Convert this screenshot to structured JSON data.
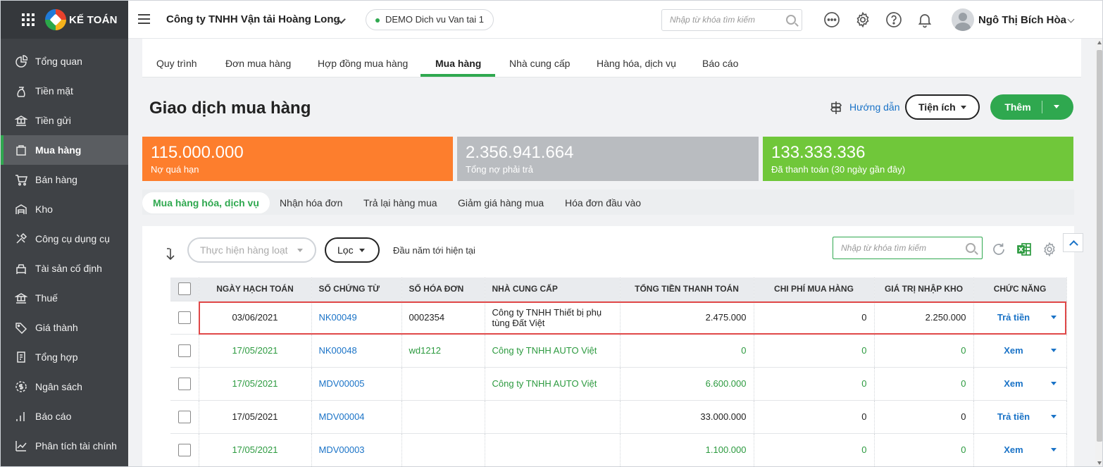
{
  "app": {
    "logo_text": "KẾ TOÁN"
  },
  "sidebar": {
    "items": [
      {
        "label": "Tổng quan",
        "icon": "dashboard-icon"
      },
      {
        "label": "Tiền mặt",
        "icon": "money-bag-icon"
      },
      {
        "label": "Tiền gửi",
        "icon": "bank-deposit-icon"
      },
      {
        "label": "Mua hàng",
        "icon": "purchase-icon"
      },
      {
        "label": "Bán hàng",
        "icon": "cart-icon"
      },
      {
        "label": "Kho",
        "icon": "warehouse-icon"
      },
      {
        "label": "Công cụ dụng cụ",
        "icon": "tools-icon"
      },
      {
        "label": "Tài sản cố định",
        "icon": "fixed-asset-icon"
      },
      {
        "label": "Thuế",
        "icon": "tax-icon"
      },
      {
        "label": "Giá thành",
        "icon": "price-tag-icon"
      },
      {
        "label": "Tổng hợp",
        "icon": "summary-icon"
      },
      {
        "label": "Ngân sách",
        "icon": "budget-icon"
      },
      {
        "label": "Báo cáo",
        "icon": "report-icon"
      },
      {
        "label": "Phân tích tài chính",
        "icon": "analysis-icon"
      }
    ],
    "active_index": 3
  },
  "header": {
    "company": "Công ty TNHH Vận tải Hoàng Long",
    "database": "DEMO Dich vu Van tai 1",
    "search_placeholder": "Nhập từ khóa tìm kiếm",
    "user_name": "Ngô Thị Bích Hòa"
  },
  "tabs": [
    "Quy trình",
    "Đơn mua hàng",
    "Hợp đồng mua hàng",
    "Mua hàng",
    "Nhà cung cấp",
    "Hàng hóa, dịch vụ",
    "Báo cáo"
  ],
  "active_tab": "Mua hàng",
  "page": {
    "title": "Giao dịch mua hàng",
    "guide_label": "Hướng dẫn",
    "utility_label": "Tiện ích",
    "add_label": "Thêm"
  },
  "summary_cards": [
    {
      "value": "115.000.000",
      "label": "Nợ quá hạn",
      "color": "#fd7e2d"
    },
    {
      "value": "2.356.941.664",
      "label": "Tổng nợ phải trả",
      "color": "#b9bcc0"
    },
    {
      "value": "133.333.336",
      "label": "Đã thanh toán (30 ngày gần đây)",
      "color": "#70c73a"
    }
  ],
  "subtabs": [
    "Mua hàng hóa, dịch vụ",
    "Nhận hóa đơn",
    "Trả lại hàng mua",
    "Giảm giá hàng mua",
    "Hóa đơn đầu vào"
  ],
  "toolbar": {
    "bulk_label": "Thực hiện hàng loạt",
    "filter_label": "Lọc",
    "period": "Đầu năm tới hiện tại",
    "search_placeholder": "Nhập từ khóa tìm kiếm"
  },
  "table": {
    "columns": [
      "NGÀY HẠCH TOÁN",
      "SỐ CHỨNG TỪ",
      "SỐ HÓA ĐƠN",
      "NHÀ CUNG CẤP",
      "TỔNG TIỀN THANH TOÁN",
      "CHI PHÍ MUA HÀNG",
      "GIÁ TRỊ NHẬP KHO",
      "CHỨC NĂNG"
    ],
    "rows": [
      {
        "date": "03/06/2021",
        "doc_no": "NK00049",
        "invoice_no": "0002354",
        "supplier": "Công ty TNHH Thiết bị phụ tùng Đất Việt",
        "total": "2.475.000",
        "cost": "0",
        "stock_value": "2.250.000",
        "action": "Trả tiền",
        "green": false
      },
      {
        "date": "17/05/2021",
        "doc_no": "NK00048",
        "invoice_no": "wd1212",
        "supplier": "Công ty TNHH AUTO Việt",
        "total": "0",
        "cost": "0",
        "stock_value": "0",
        "action": "Xem",
        "green": true
      },
      {
        "date": "17/05/2021",
        "doc_no": "MDV00005",
        "invoice_no": "",
        "supplier": "Công ty TNHH AUTO Việt",
        "total": "6.600.000",
        "cost": "0",
        "stock_value": "0",
        "action": "Xem",
        "green": true
      },
      {
        "date": "17/05/2021",
        "doc_no": "MDV00004",
        "invoice_no": "",
        "supplier": "",
        "total": "33.000.000",
        "cost": "0",
        "stock_value": "0",
        "action": "Trả tiền",
        "green": false
      },
      {
        "date": "17/05/2021",
        "doc_no": "MDV00003",
        "invoice_no": "",
        "supplier": "",
        "total": "1.100.000",
        "cost": "0",
        "stock_value": "0",
        "action": "Xem",
        "green": true
      }
    ]
  }
}
